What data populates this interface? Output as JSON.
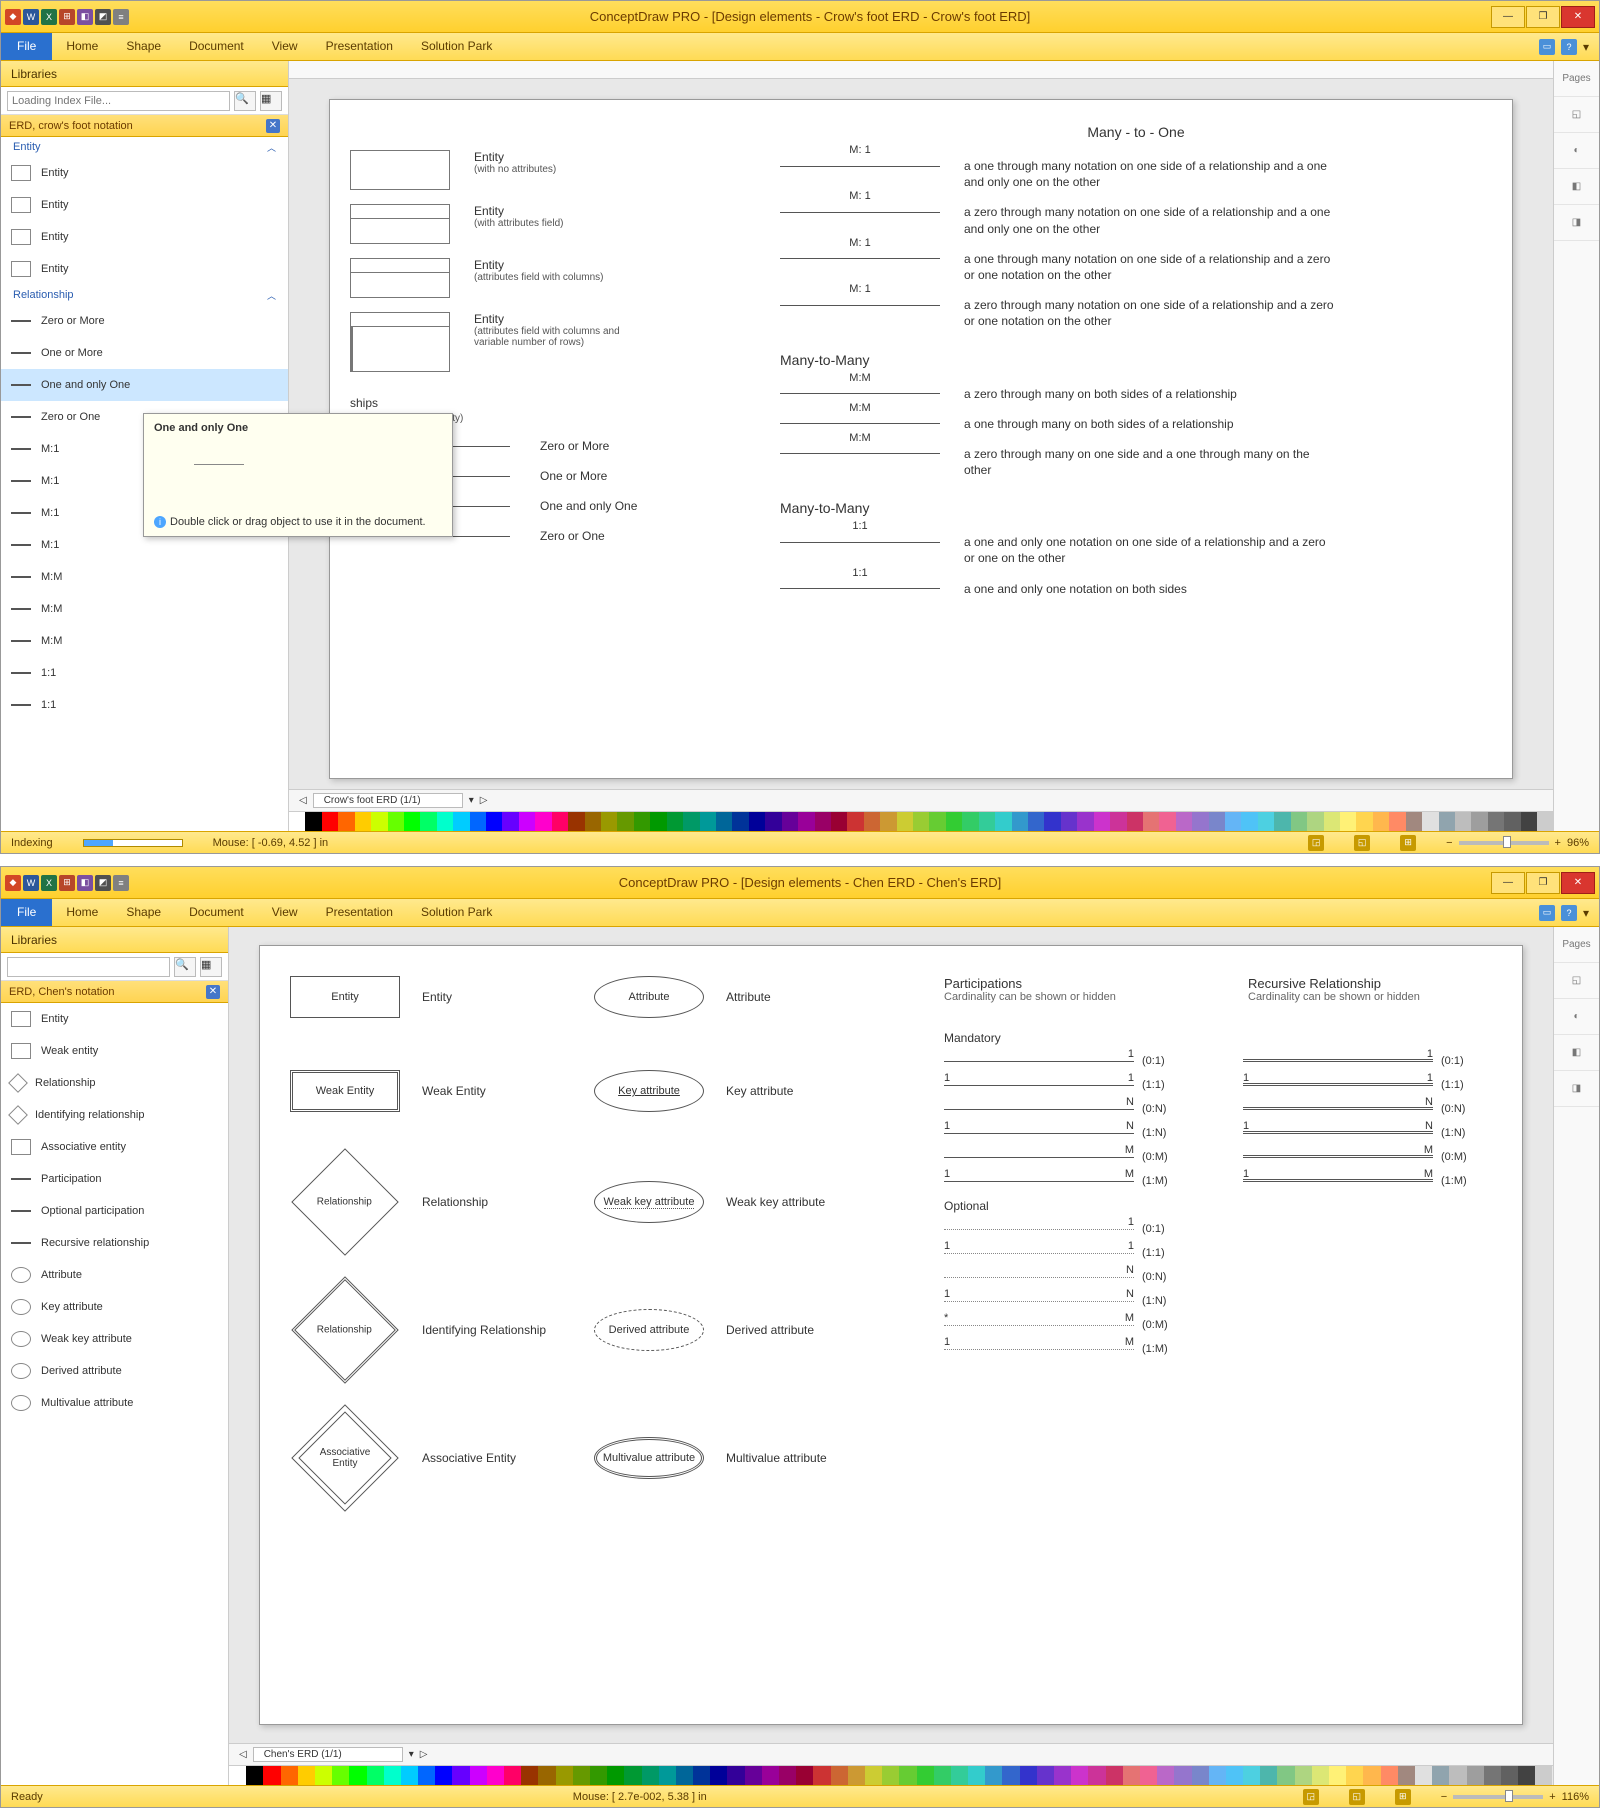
{
  "app1": {
    "title": "ConceptDraw PRO - [Design elements - Crow's foot ERD - Crow's foot ERD]",
    "menus": [
      "File",
      "Home",
      "Shape",
      "Document",
      "View",
      "Presentation",
      "Solution Park"
    ],
    "sidebar_title": "Libraries",
    "search_placeholder": "Loading Index File...",
    "lib_section": "ERD, crow's foot notation",
    "group_entity": "Entity",
    "group_relationship": "Relationship",
    "entity_items": [
      "Entity",
      "Entity",
      "Entity",
      "Entity"
    ],
    "rel_items": [
      "Zero or More",
      "One or More",
      "One and only One",
      "Zero or One",
      "M:1",
      "M:1",
      "M:1",
      "M:1",
      "M:M",
      "M:M",
      "M:M",
      "1:1",
      "1:1"
    ],
    "tooltip_title": "One and only One",
    "tooltip_hint": "Double click or drag object to use it in the document.",
    "page_tab": "Crow's foot ERD (1/1)",
    "status_left": "Indexing",
    "status_mid": "Mouse: [ -0.69, 4.52 ] in",
    "zoom": "96%",
    "doc": {
      "h1": "Many - to - One",
      "entities": [
        {
          "title": "Entity",
          "sub": "(with no attributes)"
        },
        {
          "title": "Entity",
          "sub": "(with attributes field)"
        },
        {
          "title": "Entity",
          "sub": "(attributes field with columns)"
        },
        {
          "title": "Entity",
          "sub": "(attributes field with columns and variable number of rows)"
        }
      ],
      "m1_rows": [
        {
          "lbl": "M: 1",
          "desc": "a one through many notation on one side of a relationship and a one and only one on the other"
        },
        {
          "lbl": "M: 1",
          "desc": "a zero through many notation on one side of a relationship and a one and only one on the other"
        },
        {
          "lbl": "M: 1",
          "desc": "a one through many notation on one side of a relationship and a zero or one notation on the other"
        },
        {
          "lbl": "M: 1",
          "desc": "a zero through many notation on one side of a relationship and a zero or one notation on the other"
        }
      ],
      "h2": "Many-to-Many",
      "mm_rows": [
        {
          "lbl": "M:M",
          "desc": "a zero through many on both sides of a relationship"
        },
        {
          "lbl": "M:M",
          "desc": "a one through many on both sides of a relationship"
        },
        {
          "lbl": "M:M",
          "desc": "a zero through many on one side and a one through many on the other"
        }
      ],
      "rel_title": "ships",
      "rel_sub": "(Cardinality and Modality)",
      "rel_list": [
        "Zero or More",
        "One or More",
        "One and only One",
        "Zero or One"
      ],
      "h3": "Many-to-Many",
      "oo_rows": [
        {
          "lbl": "1:1",
          "desc": "a one and only one notation on one side of a relationship and a zero or one on the other"
        },
        {
          "lbl": "1:1",
          "desc": "a one and only one notation on both sides"
        }
      ]
    }
  },
  "app2": {
    "title": "ConceptDraw PRO - [Design elements - Chen ERD - Chen's ERD]",
    "menus": [
      "File",
      "Home",
      "Shape",
      "Document",
      "View",
      "Presentation",
      "Solution Park"
    ],
    "sidebar_title": "Libraries",
    "lib_section": "ERD, Chen's notation",
    "items": [
      "Entity",
      "Weak entity",
      "Relationship",
      "Identifying relationship",
      "Associative entity",
      "Participation",
      "Optional participation",
      "Recursive relationship",
      "Attribute",
      "Key attribute",
      "Weak key attribute",
      "Derived attribute",
      "Multivalue attribute"
    ],
    "page_tab": "Chen's ERD (1/1)",
    "status_left": "Ready",
    "status_mid": "Mouse: [ 2.7e-002, 5.38 ] in",
    "zoom": "116%",
    "doc": {
      "shapes": [
        {
          "shape": "Entity",
          "label": "Entity",
          "attr": "Attribute",
          "attr_label": "Attribute"
        },
        {
          "shape": "Weak Entity",
          "label": "Weak Entity",
          "attr": "Key attribute",
          "attr_label": "Key attribute"
        },
        {
          "shape": "Relationship",
          "label": "Relationship",
          "attr": "Weak key attribute",
          "attr_label": "Weak key attribute"
        },
        {
          "shape": "Relationship",
          "label": "Identifying Relationship",
          "attr": "Derived attribute",
          "attr_label": "Derived attribute"
        },
        {
          "shape": "Associative Entity",
          "label": "Associative Entity",
          "attr": "Multivalue attribute",
          "attr_label": "Multivalue attribute"
        }
      ],
      "hdr1": "Participations",
      "hdr2": "Recursive Relationship",
      "hdr_sub": "Cardinality can be shown or hidden",
      "mandatory": "Mandatory",
      "optional": "Optional",
      "card_rows_mandatory": [
        {
          "l": "",
          "r": "1",
          "note": "(0:1)"
        },
        {
          "l": "1",
          "r": "1",
          "note": "(1:1)"
        },
        {
          "l": "",
          "r": "N",
          "note": "(0:N)"
        },
        {
          "l": "1",
          "r": "N",
          "note": "(1:N)"
        },
        {
          "l": "",
          "r": "M",
          "note": "(0:M)"
        },
        {
          "l": "1",
          "r": "M",
          "note": "(1:M)"
        }
      ],
      "card_rows_optional": [
        {
          "l": "",
          "r": "1",
          "note": "(0:1)"
        },
        {
          "l": "1",
          "r": "1",
          "note": "(1:1)"
        },
        {
          "l": "",
          "r": "N",
          "note": "(0:N)"
        },
        {
          "l": "1",
          "r": "N",
          "note": "(1:N)"
        },
        {
          "l": "*",
          "r": "M",
          "note": "(0:M)"
        },
        {
          "l": "1",
          "r": "M",
          "note": "(1:M)"
        }
      ]
    }
  },
  "palette": [
    "#ffffff",
    "#000000",
    "#ff0000",
    "#ff6600",
    "#ffcc00",
    "#ccff00",
    "#66ff00",
    "#00ff00",
    "#00ff66",
    "#00ffcc",
    "#00ccff",
    "#0066ff",
    "#0000ff",
    "#6600ff",
    "#cc00ff",
    "#ff00cc",
    "#ff0066",
    "#993300",
    "#996600",
    "#999900",
    "#669900",
    "#339900",
    "#009900",
    "#009933",
    "#009966",
    "#009999",
    "#006699",
    "#003399",
    "#000099",
    "#330099",
    "#660099",
    "#990099",
    "#990066",
    "#990033",
    "#cc3333",
    "#cc6633",
    "#cc9933",
    "#cccc33",
    "#99cc33",
    "#66cc33",
    "#33cc33",
    "#33cc66",
    "#33cc99",
    "#33cccc",
    "#3399cc",
    "#3366cc",
    "#3333cc",
    "#6633cc",
    "#9933cc",
    "#cc33cc",
    "#cc3399",
    "#cc3366",
    "#e57373",
    "#f06292",
    "#ba68c8",
    "#9575cd",
    "#7986cb",
    "#64b5f6",
    "#4fc3f7",
    "#4dd0e1",
    "#4db6ac",
    "#81c784",
    "#aed581",
    "#dce775",
    "#fff176",
    "#ffd54f",
    "#ffb74d",
    "#ff8a65",
    "#a1887f",
    "#e0e0e0",
    "#90a4ae",
    "#bdbdbd",
    "#9e9e9e",
    "#757575",
    "#616161",
    "#424242",
    "#cccccc"
  ]
}
